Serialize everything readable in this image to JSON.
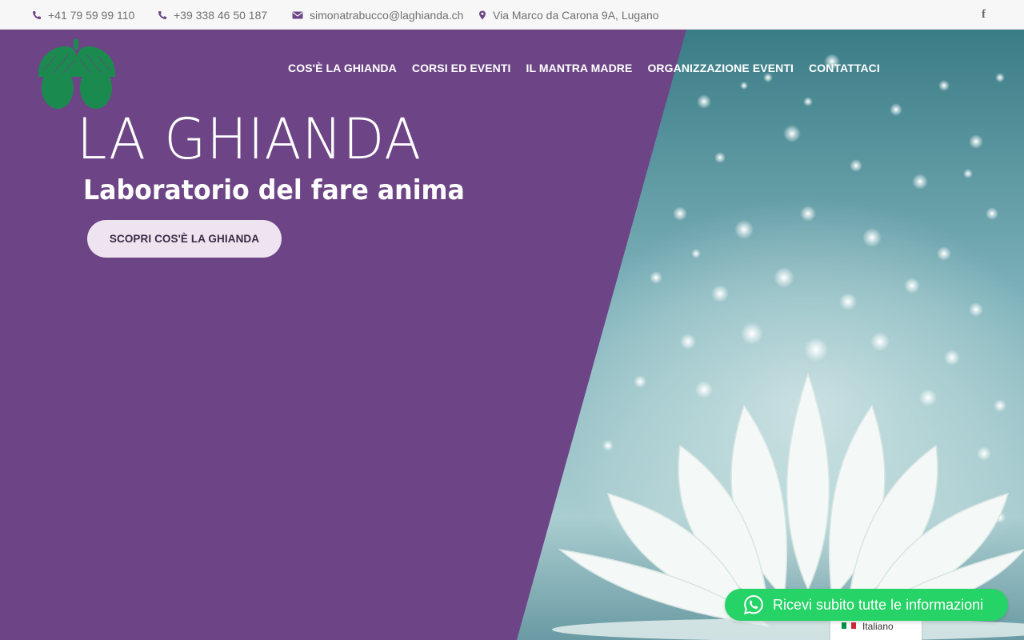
{
  "topbar": {
    "phone_ch": "+41 79 59 99 110",
    "phone_it": "+39 338 46 50 187",
    "email": "simonatrabucco@laghianda.ch",
    "address": "Via Marco da Carona 9A, Lugano",
    "social_icon": "facebook-icon",
    "social_glyph": "f"
  },
  "nav": {
    "items": [
      "COS'È LA GHIANDA",
      "CORSI ED EVENTI",
      "IL MANTRA MADRE",
      "ORGANIZZAZIONE EVENTI",
      "CONTATTACI"
    ]
  },
  "hero": {
    "title": "LA GHIANDA",
    "subtitle": "Laboratorio del fare anima",
    "cta_label": "SCOPRI COS'È LA GHIANDA"
  },
  "whatsapp": {
    "label": "Ricevi subito tutte le informazioni"
  },
  "language": {
    "label": "Italiano"
  },
  "colors": {
    "brand_purple": "#6d4586",
    "logo_green": "#1b8a4f",
    "whatsapp_green": "#25d366",
    "icon_purple": "#6d4586"
  }
}
